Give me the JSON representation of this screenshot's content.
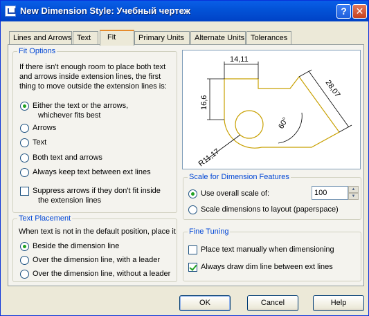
{
  "window": {
    "title": "New Dimension Style: Учебный чертеж",
    "help_glyph": "?",
    "close_glyph": "✕"
  },
  "tabs": [
    {
      "label": "Lines and Arrows",
      "active": false
    },
    {
      "label": "Text",
      "active": false
    },
    {
      "label": "Fit",
      "active": true
    },
    {
      "label": "Primary Units",
      "active": false
    },
    {
      "label": "Alternate Units",
      "active": false
    },
    {
      "label": "Tolerances",
      "active": false
    }
  ],
  "fit_options": {
    "legend": "Fit Options",
    "description_lines": [
      "If there isn't enough room to place both text",
      "and arrows inside extension lines, the first",
      "thing to move outside the extension lines is:"
    ],
    "options": [
      {
        "line1": "Either the text or the arrows,",
        "line2": "whichever fits best",
        "selected": true
      },
      {
        "line1": "Arrows",
        "selected": false
      },
      {
        "line1": "Text",
        "selected": false
      },
      {
        "line1": "Both text and arrows",
        "selected": false
      },
      {
        "line1": "Always keep text between ext lines",
        "selected": false
      }
    ],
    "suppress": {
      "line1": "Suppress arrows if they don't fit inside",
      "line2": "the extension lines",
      "checked": false
    }
  },
  "text_placement": {
    "legend": "Text Placement",
    "description": "When text is not in the default position, place it",
    "options": [
      {
        "label": "Beside the dimension line",
        "selected": true
      },
      {
        "label": "Over the dimension line, with a leader",
        "selected": false
      },
      {
        "label": "Over the dimension line, without a leader",
        "selected": false
      }
    ]
  },
  "preview": {
    "dim_top": "14,11",
    "dim_left": "16,6",
    "dim_right": "28,07",
    "dim_angle": "60°",
    "dim_radius": "R11,17",
    "colors": {
      "geometry": "#c8a000",
      "dims": "#000000"
    }
  },
  "scale": {
    "legend": "Scale for Dimension Features",
    "overall_label": "Use overall scale of:",
    "overall_selected": true,
    "overall_value": "100",
    "layout_label": "Scale dimensions to layout (paperspace)",
    "layout_selected": false
  },
  "fine_tuning": {
    "legend": "Fine Tuning",
    "manual": {
      "label": "Place text manually when dimensioning",
      "checked": false
    },
    "always_draw": {
      "label": "Always draw dim line between ext lines",
      "checked": true
    }
  },
  "buttons": {
    "ok": "OK",
    "cancel": "Cancel",
    "help": "Help"
  }
}
